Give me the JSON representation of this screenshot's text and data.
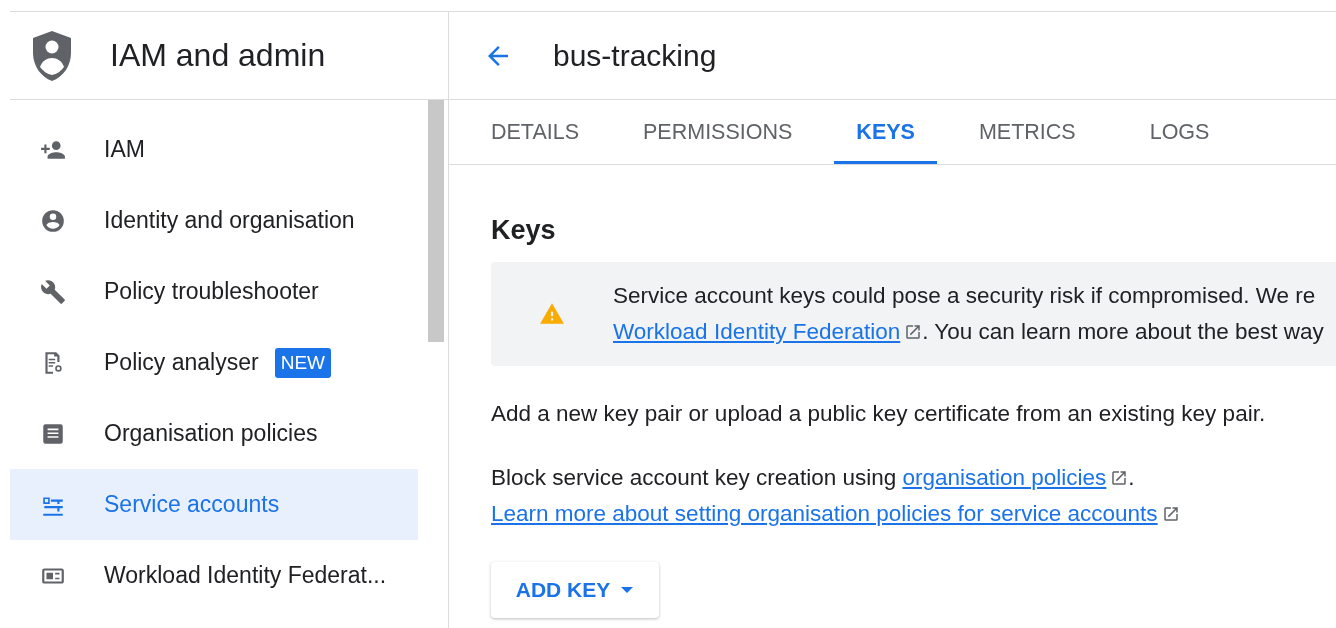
{
  "sidebar": {
    "title": "IAM and admin",
    "items": [
      {
        "label": "IAM",
        "selected": false
      },
      {
        "label": "Identity and organisation",
        "selected": false
      },
      {
        "label": "Policy troubleshooter",
        "selected": false
      },
      {
        "label": "Policy analyser",
        "badge": "NEW",
        "selected": false
      },
      {
        "label": "Organisation policies",
        "selected": false
      },
      {
        "label": "Service accounts",
        "selected": true
      },
      {
        "label": "Workload Identity Federat...",
        "selected": false
      }
    ]
  },
  "header": {
    "title": "bus-tracking"
  },
  "tabs": [
    {
      "label": "DETAILS",
      "selected": false
    },
    {
      "label": "PERMISSIONS",
      "selected": false
    },
    {
      "label": "KEYS",
      "selected": true
    },
    {
      "label": "METRICS",
      "selected": false
    },
    {
      "label": "LOGS",
      "selected": false
    }
  ],
  "content": {
    "heading": "Keys",
    "warning": {
      "line_1": "Service account keys could pose a security risk if compromised. We re",
      "link": "Workload Identity Federation",
      "line_2_rest": ". You can learn more about the best way"
    },
    "intro": "Add a new key pair or upload a public key certificate from an existing key pair.",
    "block": {
      "text": "Block service account key creation using ",
      "link": "organisation policies",
      "end": "."
    },
    "learn_link": "Learn more about setting organisation policies for service accounts",
    "add_key_button": "ADD KEY"
  }
}
